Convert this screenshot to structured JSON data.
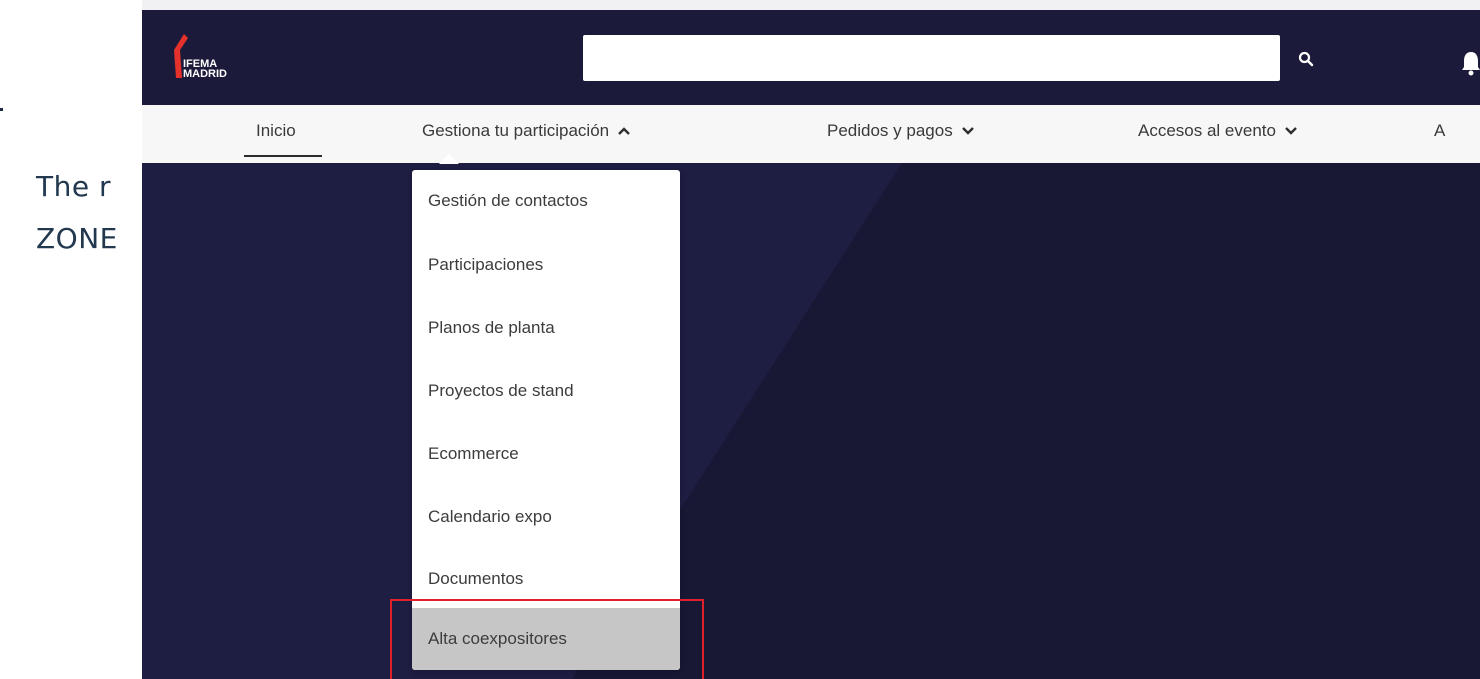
{
  "document": {
    "line1": "The r",
    "line2": "ZONE"
  },
  "header": {
    "logo_line1": "IFEMA",
    "logo_line2": "MADRID",
    "search_value": "",
    "search_icon": "search-icon",
    "bell_icon": "bell-icon"
  },
  "nav": {
    "items": [
      {
        "label": "Inicio",
        "active": true
      },
      {
        "label": "Gestiona tu participación",
        "chevron": "up"
      },
      {
        "label": "Pedidos y pagos",
        "chevron": "down"
      },
      {
        "label": "Accesos al evento",
        "chevron": "down"
      },
      {
        "label": "A"
      }
    ]
  },
  "dropdown": {
    "items": [
      {
        "label": "Gestión de contactos"
      },
      {
        "label": "Participaciones"
      },
      {
        "label": "Planos de planta"
      },
      {
        "label": "Proyectos de stand"
      },
      {
        "label": "Ecommerce"
      },
      {
        "label": "Calendario expo"
      },
      {
        "label": "Documentos"
      },
      {
        "label": "Alta coexpositores",
        "highlighted": true
      }
    ]
  },
  "colors": {
    "header_bg": "#1b1a3a",
    "page_bg": "#181734",
    "nav_bg": "#f7f7f7",
    "highlight": "#c6c6c6",
    "annotation_red": "#e0202a",
    "logo_red": "#e4312b"
  }
}
